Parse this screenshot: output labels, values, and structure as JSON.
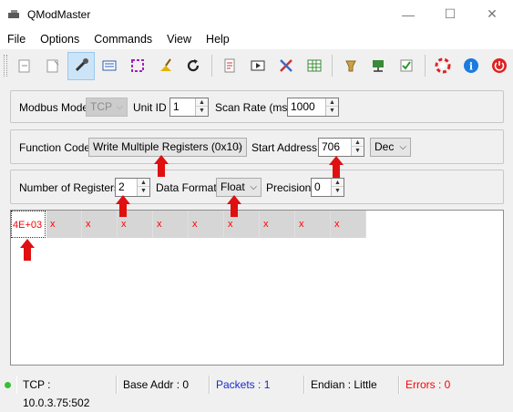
{
  "window": {
    "title": "QModMaster"
  },
  "menu": [
    "File",
    "Options",
    "Commands",
    "View",
    "Help"
  ],
  "toolbar": {
    "buttons": [
      {
        "name": "connect-icon"
      },
      {
        "name": "disconnect-icon"
      },
      {
        "name": "plug-icon",
        "active": true
      },
      {
        "name": "read-write-icon"
      },
      {
        "name": "scan-icon"
      },
      {
        "name": "clear-icon"
      },
      {
        "name": "refresh-icon"
      },
      {
        "name": "log-icon"
      },
      {
        "name": "bus-monitor-icon"
      },
      {
        "name": "tools-icon"
      },
      {
        "name": "registers-icon"
      },
      {
        "name": "serial-settings-icon"
      },
      {
        "name": "tcp-settings-icon"
      },
      {
        "name": "settings-check-icon"
      },
      {
        "name": "help-icon"
      },
      {
        "name": "info-icon"
      },
      {
        "name": "exit-icon"
      }
    ]
  },
  "modbus": {
    "mode_label": "Modbus Mode",
    "mode_value": "TCP",
    "unit_id_label": "Unit ID",
    "unit_id_value": "1",
    "scan_rate_label": "Scan Rate (ms)",
    "scan_rate_value": "1000"
  },
  "function": {
    "label": "Function Code",
    "value": "Write Multiple Registers (0x10)",
    "start_label": "Start Address",
    "start_value": "706",
    "format_value": "Dec"
  },
  "registers": {
    "count_label": "Number of Registers",
    "count_value": "2",
    "format_label": "Data Format",
    "format_value": "Float",
    "precision_label": "Precision",
    "precision_value": "0"
  },
  "grid": {
    "cells": [
      "4E+03",
      "x",
      "x",
      "x",
      "x",
      "x",
      "x",
      "x",
      "x",
      "x"
    ]
  },
  "status": {
    "connection": "TCP : 10.0.3.75:502",
    "base_addr": "Base Addr : 0",
    "packets": "Packets : 1",
    "endian": "Endian : Little",
    "errors": "Errors : 0"
  },
  "colors": {
    "error_text": "#ff0000",
    "packets_text": "#1a2bcc",
    "annotation_arrow": "#e01010",
    "status_led": "#34c034"
  }
}
